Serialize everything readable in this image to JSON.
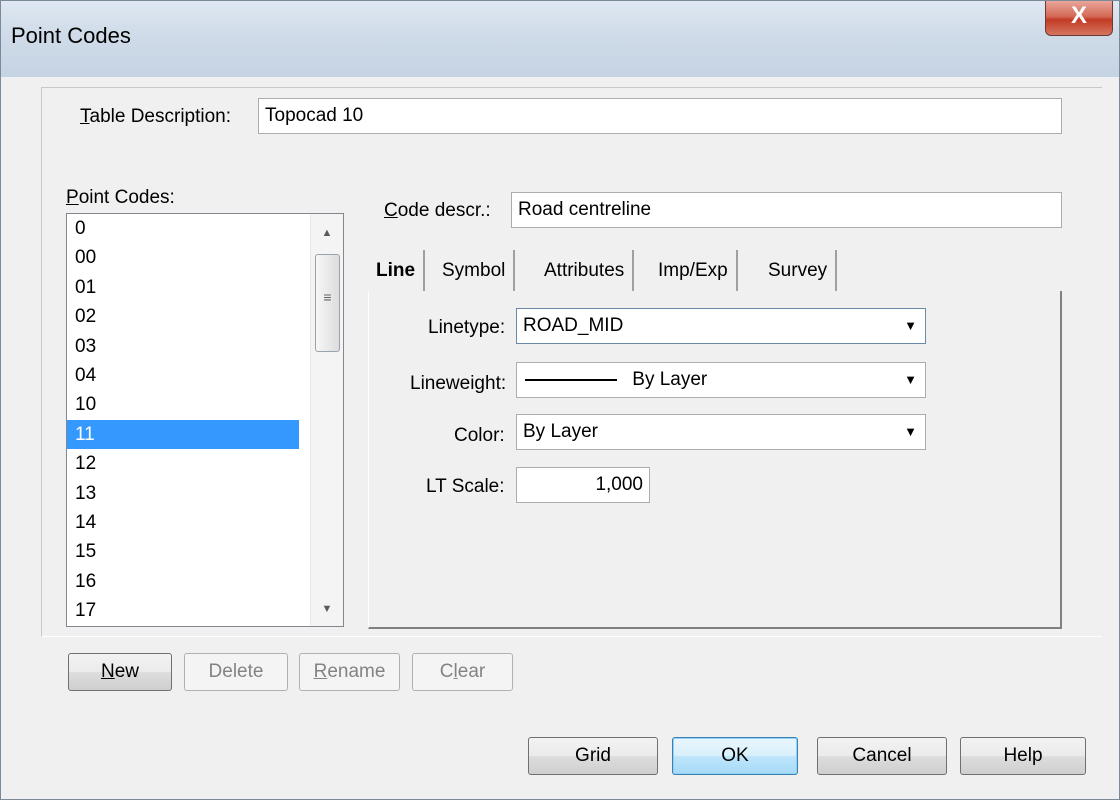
{
  "window": {
    "title": "Point Codes",
    "close_label": "X"
  },
  "table_description": {
    "label": "able Description:",
    "label_mnemonic": "T",
    "value": "Topocad 10"
  },
  "point_codes": {
    "label": "oint Codes:",
    "label_mnemonic": "P",
    "items": [
      "0",
      "00",
      "01",
      "02",
      "03",
      "04",
      "10",
      "11",
      "12",
      "13",
      "14",
      "15",
      "16",
      "17"
    ],
    "selected": "11"
  },
  "code_descr": {
    "label": "ode descr.:",
    "label_mnemonic": "C",
    "value": "Road centreline"
  },
  "tabs": [
    "Line",
    "Symbol",
    "Attributes",
    "Imp/Exp",
    "Survey"
  ],
  "active_tab": "Line",
  "line_tab": {
    "linetype": {
      "label": "Linetype:",
      "value": "ROAD_MID"
    },
    "lineweight": {
      "label": "Lineweight:",
      "value": "By Layer"
    },
    "color": {
      "label": "Color:",
      "value": "By Layer"
    },
    "lt_scale": {
      "label": "LT Scale:",
      "value": "1,000"
    }
  },
  "list_buttons": {
    "new": {
      "mnemonic": "N",
      "rest": "ew"
    },
    "delete": {
      "label": "Delete"
    },
    "rename": {
      "mnemonic": "R",
      "rest": "ename"
    },
    "clear": {
      "pre": "C",
      "mnemonic": "l",
      "rest": "ear"
    }
  },
  "dialog_buttons": {
    "grid": "Grid",
    "ok": "OK",
    "cancel": "Cancel",
    "help": "Help"
  }
}
